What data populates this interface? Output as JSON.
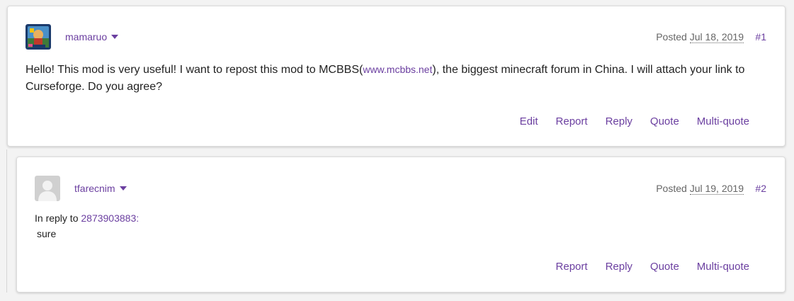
{
  "colors": {
    "accent": "#6b3fa0",
    "text": "#222222",
    "muted": "#666666"
  },
  "posts": [
    {
      "username": "mamaruo",
      "posted_label": "Posted",
      "date": "Jul 18, 2019",
      "number": "#1",
      "body_before": "Hello! This mod is very useful! I want to repost this mod to MCBBS(",
      "body_link": "www.mcbbs.net",
      "body_after": "), the biggest minecraft forum in China. I will attach your link to Curseforge. Do you agree?",
      "actions": [
        "Edit",
        "Report",
        "Reply",
        "Quote",
        "Multi-quote"
      ]
    },
    {
      "username": "tfarecnim",
      "posted_label": "Posted",
      "date": "Jul 19, 2019",
      "number": "#2",
      "reply_label": "In reply to",
      "reply_user": "2873903883:",
      "body": "sure",
      "actions": [
        "Report",
        "Reply",
        "Quote",
        "Multi-quote"
      ]
    }
  ]
}
